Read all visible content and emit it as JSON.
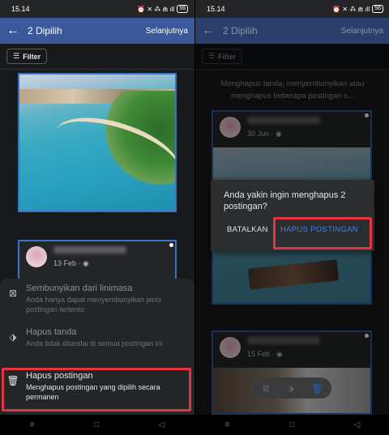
{
  "status": {
    "time": "15.14",
    "icons": "⏰ ✕ ⁂ ⋒ ıll",
    "battery": "56"
  },
  "appbar": {
    "title": "2 Dipilih",
    "next_label": "Selanjutnya"
  },
  "filter": {
    "label": "Filter"
  },
  "left": {
    "post_date": "13 Feb · ◉",
    "sheet": {
      "items": [
        {
          "title": "Sembunyikan dari linimasa",
          "desc": "Anda hanya dapat menyembunyikan jenis postingan tertentu",
          "icon": "hide-icon"
        },
        {
          "title": "Hapus tanda",
          "desc": "Anda tidak ditandai di semua postingan ini",
          "icon": "tag-icon"
        },
        {
          "title": "Hapus postingan",
          "desc": "Menghapus postingan yang dipilih secara permanen",
          "icon": "trash-icon"
        }
      ]
    }
  },
  "right": {
    "info": "Menghapus tanda, menyembunyikan atau menghapus beberapa postingan s...",
    "post1_date": "30 Jun · ◉",
    "post2_date": "15 Feb · ◉",
    "dialog": {
      "message": "Anda yakin ingin menghapus 2 postingan?",
      "cancel": "BATALKAN",
      "confirm": "HAPUS POSTINGAN"
    }
  },
  "colors": {
    "appbar": "#3b5998",
    "selection": "#3b73c7",
    "highlight": "#e53340",
    "confirm": "#3b82f6"
  }
}
